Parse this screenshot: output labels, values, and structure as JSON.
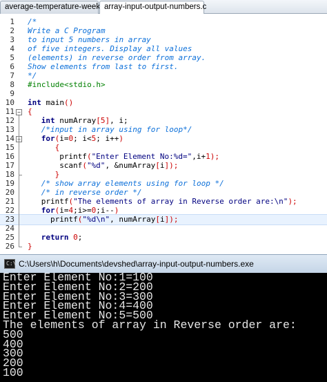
{
  "editor": {
    "tabs": [
      {
        "label": "average-temperature-week.c",
        "active": false
      },
      {
        "label": "array-input-output-numbers.c",
        "active": true
      }
    ],
    "current_line": 23,
    "lines": [
      {
        "n": "1",
        "indent": 0,
        "tokens": [
          {
            "t": "/*",
            "k": "comment"
          }
        ]
      },
      {
        "n": "2",
        "indent": 0,
        "tokens": [
          {
            "t": "Write a C Program",
            "k": "comment"
          }
        ]
      },
      {
        "n": "3",
        "indent": 0,
        "tokens": [
          {
            "t": "to input 5 numbers in array",
            "k": "comment"
          }
        ]
      },
      {
        "n": "4",
        "indent": 0,
        "tokens": [
          {
            "t": "of five integers. Display all values",
            "k": "comment"
          }
        ]
      },
      {
        "n": "5",
        "indent": 0,
        "tokens": [
          {
            "t": "(elements) in reverse order from array.",
            "k": "comment"
          }
        ]
      },
      {
        "n": "6",
        "indent": 0,
        "tokens": [
          {
            "t": "Show elements from last to first.",
            "k": "comment"
          }
        ]
      },
      {
        "n": "7",
        "indent": 0,
        "tokens": [
          {
            "t": "*/",
            "k": "comment"
          }
        ]
      },
      {
        "n": "8",
        "indent": 0,
        "tokens": [
          {
            "t": "#include<stdio.h>",
            "k": "pre"
          }
        ]
      },
      {
        "n": "9",
        "indent": 0,
        "tokens": []
      },
      {
        "n": "10",
        "indent": 0,
        "tokens": [
          {
            "t": "int",
            "k": "kw"
          },
          {
            "t": " main",
            "k": "plain"
          },
          {
            "t": "()",
            "k": "paren"
          }
        ]
      },
      {
        "n": "11",
        "indent": 0,
        "fold": "-",
        "tokens": [
          {
            "t": "{",
            "k": "paren"
          }
        ]
      },
      {
        "n": "12",
        "indent": 3,
        "tokens": [
          {
            "t": "int",
            "k": "kw"
          },
          {
            "t": " numArray",
            "k": "plain"
          },
          {
            "t": "[",
            "k": "paren"
          },
          {
            "t": "5",
            "k": "num"
          },
          {
            "t": "]",
            "k": "paren"
          },
          {
            "t": ", i;",
            "k": "plain"
          }
        ]
      },
      {
        "n": "13",
        "indent": 3,
        "tokens": [
          {
            "t": "/*input in array using for loop*/",
            "k": "comment"
          }
        ]
      },
      {
        "n": "14",
        "indent": 3,
        "fold": "-",
        "tokens": [
          {
            "t": "for",
            "k": "kw"
          },
          {
            "t": "(",
            "k": "paren"
          },
          {
            "t": "i=",
            "k": "plain"
          },
          {
            "t": "0",
            "k": "num"
          },
          {
            "t": "; i<",
            "k": "plain"
          },
          {
            "t": "5",
            "k": "num"
          },
          {
            "t": "; i++",
            "k": "plain"
          },
          {
            "t": ")",
            "k": "paren"
          }
        ]
      },
      {
        "n": "15",
        "indent": 6,
        "tokens": [
          {
            "t": "{",
            "k": "paren"
          }
        ]
      },
      {
        "n": "16",
        "indent": 7,
        "tokens": [
          {
            "t": "printf",
            "k": "plain"
          },
          {
            "t": "(",
            "k": "paren"
          },
          {
            "t": "\"Enter Element No:%d=\"",
            "k": "str"
          },
          {
            "t": ",i+",
            "k": "plain"
          },
          {
            "t": "1",
            "k": "num"
          },
          {
            "t": ");",
            "k": "paren"
          }
        ]
      },
      {
        "n": "17",
        "indent": 7,
        "tokens": [
          {
            "t": "scanf",
            "k": "plain"
          },
          {
            "t": "(",
            "k": "paren"
          },
          {
            "t": "\"%d\"",
            "k": "str"
          },
          {
            "t": ", &numArray",
            "k": "plain"
          },
          {
            "t": "[",
            "k": "paren"
          },
          {
            "t": "i",
            "k": "plain"
          },
          {
            "t": "]);",
            "k": "paren"
          }
        ]
      },
      {
        "n": "18",
        "indent": 6,
        "fold": "end",
        "tokens": [
          {
            "t": "}",
            "k": "paren"
          }
        ]
      },
      {
        "n": "19",
        "indent": 3,
        "tokens": [
          {
            "t": "/* show array elements using for loop */",
            "k": "comment"
          }
        ]
      },
      {
        "n": "20",
        "indent": 3,
        "tokens": [
          {
            "t": "/* in reverse order */",
            "k": "comment"
          }
        ]
      },
      {
        "n": "21",
        "indent": 3,
        "tokens": [
          {
            "t": "printf",
            "k": "plain"
          },
          {
            "t": "(",
            "k": "paren"
          },
          {
            "t": "\"The elements of array in Reverse order are:\\n\"",
            "k": "str"
          },
          {
            "t": ");",
            "k": "paren"
          }
        ]
      },
      {
        "n": "22",
        "indent": 3,
        "tokens": [
          {
            "t": "for",
            "k": "kw"
          },
          {
            "t": "(",
            "k": "paren"
          },
          {
            "t": "i=",
            "k": "plain"
          },
          {
            "t": "4",
            "k": "num"
          },
          {
            "t": ";i>=",
            "k": "plain"
          },
          {
            "t": "0",
            "k": "num"
          },
          {
            "t": ";i--",
            "k": "plain"
          },
          {
            "t": ")",
            "k": "paren"
          }
        ]
      },
      {
        "n": "23",
        "indent": 5,
        "tokens": [
          {
            "t": "printf",
            "k": "plain"
          },
          {
            "t": "(",
            "k": "paren"
          },
          {
            "t": "\"%d\\n\"",
            "k": "str"
          },
          {
            "t": ", numArray",
            "k": "plain"
          },
          {
            "t": "[",
            "k": "paren"
          },
          {
            "t": "i",
            "k": "plain"
          },
          {
            "t": "]);",
            "k": "paren"
          }
        ]
      },
      {
        "n": "24",
        "indent": 0,
        "tokens": []
      },
      {
        "n": "25",
        "indent": 3,
        "tokens": [
          {
            "t": "return",
            "k": "kw"
          },
          {
            "t": " ",
            "k": "plain"
          },
          {
            "t": "0",
            "k": "num"
          },
          {
            "t": ";",
            "k": "plain"
          }
        ]
      },
      {
        "n": "26",
        "indent": 0,
        "fold": "end",
        "tokens": [
          {
            "t": "}",
            "k": "paren"
          }
        ]
      }
    ]
  },
  "console": {
    "title": "C:\\Users\\h\\Documents\\devshed\\array-input-output-numbers.exe",
    "output": [
      "Enter Element No:1=100",
      "Enter Element No:2=200",
      "Enter Element No:3=300",
      "Enter Element No:4=400",
      "Enter Element No:5=500",
      "The elements of array in Reverse order are:",
      "500",
      "400",
      "300",
      "200",
      "100"
    ]
  },
  "colors": {
    "comment": "#0b6fd9",
    "preprocessor": "#008000",
    "keyword": "#000080",
    "bracket": "#cc0000",
    "console_bg": "#000000",
    "console_fg": "#e6e6e6",
    "current_line_bg": "#e8f2fe"
  }
}
